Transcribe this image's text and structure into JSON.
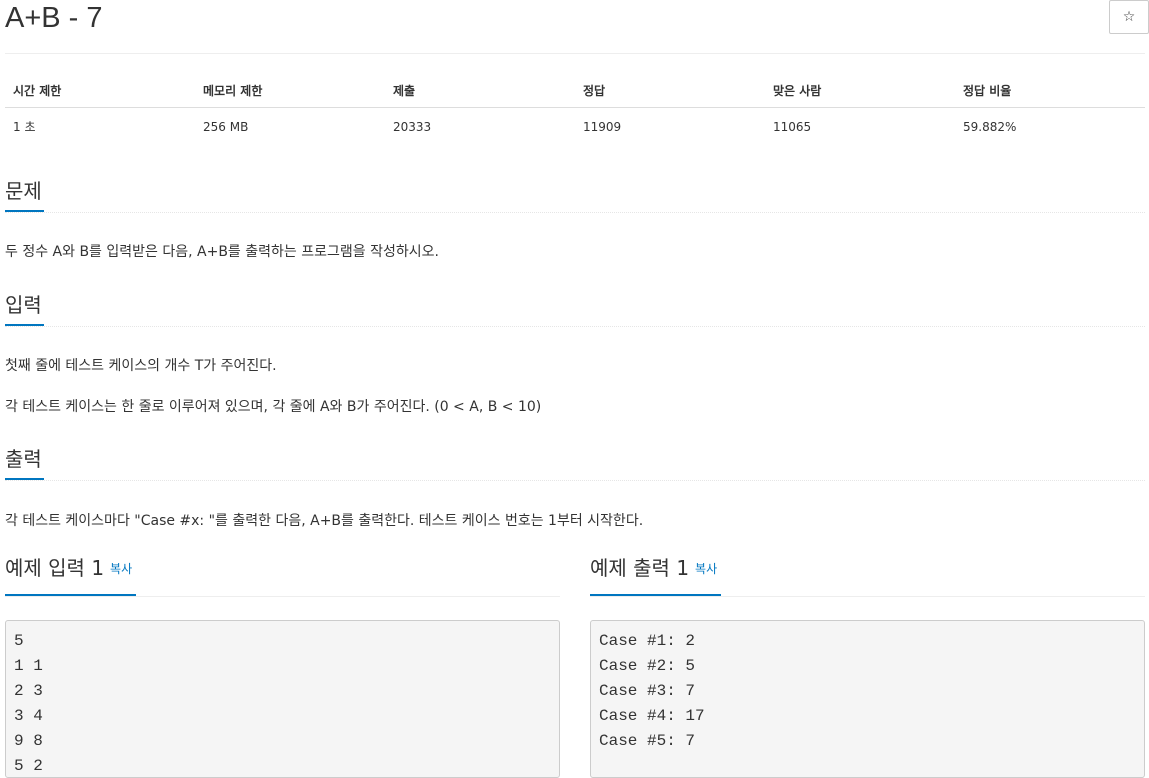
{
  "problem": {
    "title": "A+B - 7",
    "star_icon": "☆"
  },
  "info_table": {
    "headers": [
      "시간 제한",
      "메모리 제한",
      "제출",
      "정답",
      "맞은 사람",
      "정답 비율"
    ],
    "values": [
      "1 초",
      "256 MB",
      "20333",
      "11909",
      "11065",
      "59.882%"
    ]
  },
  "description": {
    "heading": "문제",
    "text": "두 정수 A와 B를 입력받은 다음, A+B를 출력하는 프로그램을 작성하시오."
  },
  "input_section": {
    "heading": "입력",
    "lines": [
      "첫째 줄에 테스트 케이스의 개수 T가 주어진다.",
      "각 테스트 케이스는 한 줄로 이루어져 있으며, 각 줄에 A와 B가 주어진다. (0 < A, B < 10)"
    ]
  },
  "output_section": {
    "heading": "출력",
    "text": "각 테스트 케이스마다 \"Case #x: \"를 출력한 다음, A+B를 출력한다. 테스트 케이스 번호는 1부터 시작한다."
  },
  "sample_input": {
    "heading": "예제 입력 1",
    "copy_label": "복사",
    "content": "5\n1 1\n2 3\n3 4\n9 8\n5 2"
  },
  "sample_output": {
    "heading": "예제 출력 1",
    "copy_label": "복사",
    "content": "Case #1: 2\nCase #2: 5\nCase #3: 7\nCase #4: 17\nCase #5: 7"
  },
  "colors": {
    "accent": "#0076c0",
    "text": "#333333",
    "code_bg": "#f5f5f5"
  }
}
